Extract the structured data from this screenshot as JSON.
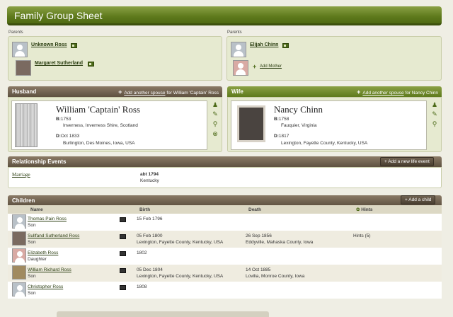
{
  "title": "Family Group Sheet",
  "parents_label": "Parents",
  "left_parents": [
    {
      "name": "Unknown Ross",
      "avatar": "male"
    },
    {
      "name": "Margaret Sutherland",
      "avatar": "photo"
    }
  ],
  "right_parents": {
    "father": {
      "name": "Elijah Chinn",
      "avatar": "male"
    },
    "add_mother": "Add Mother"
  },
  "husband": {
    "header": "Husband",
    "add_link": "Add another spouse",
    "add_suffix": "for William 'Captain' Ross",
    "name": "William 'Captain' Ross",
    "birth_label": "B:",
    "birth_date": "1753",
    "birth_place": "Inverness, Inverness Shire, Scotland",
    "death_label": "D:",
    "death_date": "Oct 1833",
    "death_place": "Burlington, Des Moines, Iowa, USA"
  },
  "wife": {
    "header": "Wife",
    "add_link": "Add another spouse",
    "add_suffix": "for Nancy Chinn",
    "name": "Nancy Chinn",
    "birth_label": "B:",
    "birth_date": "1758",
    "birth_place": "Fauquier, Virginia",
    "death_label": "D:",
    "death_date": "1817",
    "death_place": "Lexington, Fayette County, Kentucky, USA"
  },
  "relationship": {
    "header": "Relationship Events",
    "add_button": "+ Add a new life event",
    "event_name": "Marriage",
    "event_date": "abt 1794",
    "event_place": "Kentucky"
  },
  "children": {
    "header": "Children",
    "add_button": "+ Add a child",
    "columns": {
      "name": "Name",
      "birth": "Birth",
      "death": "Death",
      "hints": "Hints"
    },
    "rows": [
      {
        "name": "Thomas Pain Ross",
        "rel": "Son",
        "birth_date": "15 Feb 1796",
        "birth_place": "",
        "death_date": "",
        "death_place": "",
        "hints": "",
        "avatar": "male"
      },
      {
        "name": "Sullfand Sutherland Ross",
        "rel": "Son",
        "birth_date": "05 Feb 1800",
        "birth_place": "Lexington, Fayette County, Kentucky, USA",
        "death_date": "26 Sep 1856",
        "death_place": "Eddyville, Mahaska County, Iowa",
        "hints": "Hints (5)",
        "avatar": "photo"
      },
      {
        "name": "Elizabeth Ross",
        "rel": "Daughter",
        "birth_date": "1802",
        "birth_place": "",
        "death_date": "",
        "death_place": "",
        "hints": "",
        "avatar": "female"
      },
      {
        "name": "William Richard Ross",
        "rel": "Son",
        "birth_date": "05 Dec 1804",
        "birth_place": "Lexington, Fayette County, Kentucky, USA",
        "death_date": "14 Oct 1885",
        "death_place": "Lovilia, Monroe County, Iowa",
        "hints": "",
        "avatar": "photo"
      },
      {
        "name": "Christopher Ross",
        "rel": "Son",
        "birth_date": "1808",
        "birth_place": "",
        "death_date": "",
        "death_place": "",
        "hints": "",
        "avatar": "male"
      }
    ]
  }
}
